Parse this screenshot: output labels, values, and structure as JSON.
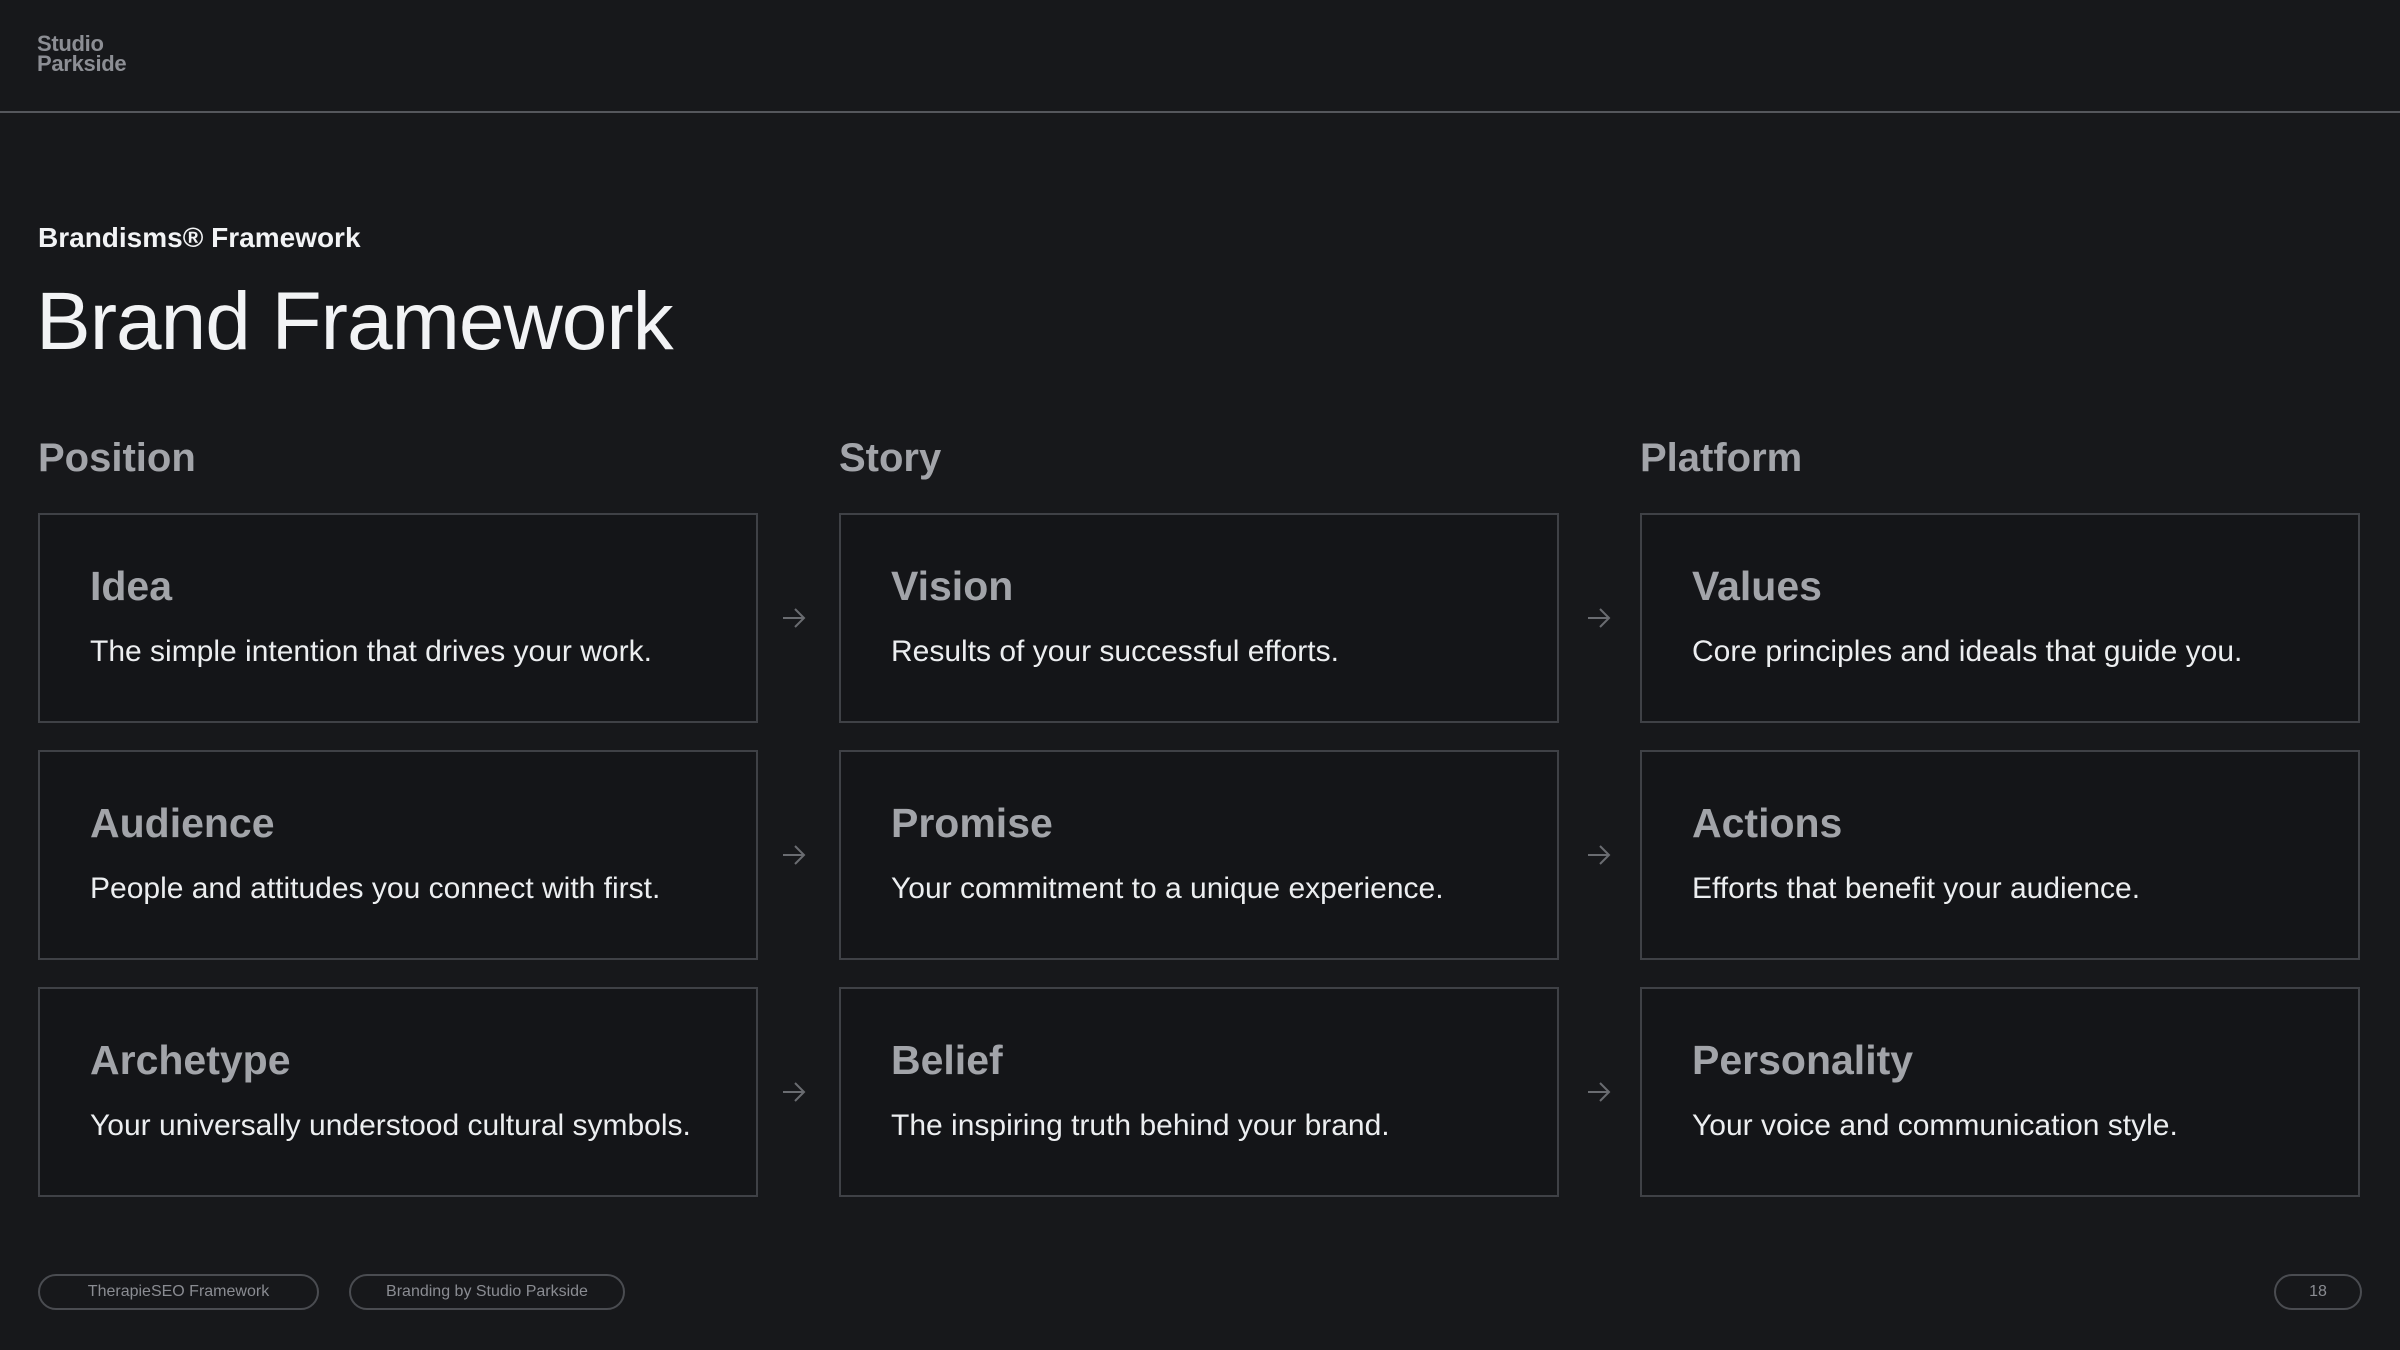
{
  "brand": {
    "logo_line1": "Studio",
    "logo_line2": "Parkside"
  },
  "header": {
    "eyebrow": "Brandisms® Framework",
    "title": "Brand Framework"
  },
  "columns": [
    {
      "label": "Position",
      "cards": [
        {
          "title": "Idea",
          "text": "The simple intention that drives your work."
        },
        {
          "title": "Audience",
          "text": "People and attitudes you connect with first."
        },
        {
          "title": "Archetype",
          "text": "Your universally understood cultural symbols."
        }
      ]
    },
    {
      "label": "Story",
      "cards": [
        {
          "title": "Vision",
          "text": "Results of your successful efforts."
        },
        {
          "title": "Promise",
          "text": "Your commitment to a unique experience."
        },
        {
          "title": "Belief",
          "text": "The inspiring truth behind your brand."
        }
      ]
    },
    {
      "label": "Platform",
      "cards": [
        {
          "title": "Values",
          "text": "Core principles and ideals that guide you."
        },
        {
          "title": "Actions",
          "text": "Efforts that benefit your audience."
        },
        {
          "title": "Personality",
          "text": "Your voice and communication style."
        }
      ]
    }
  ],
  "footer": {
    "tag1": "TherapieSEO Framework",
    "tag2": "Branding by Studio Parkside",
    "page_number": "18"
  },
  "colors": {
    "background": "#17181b",
    "card_border": "#3f4146",
    "muted_text": "#a2a4a9",
    "arrow": "#6a6c71"
  },
  "icons": {
    "arrow": "arrow-right-icon"
  }
}
